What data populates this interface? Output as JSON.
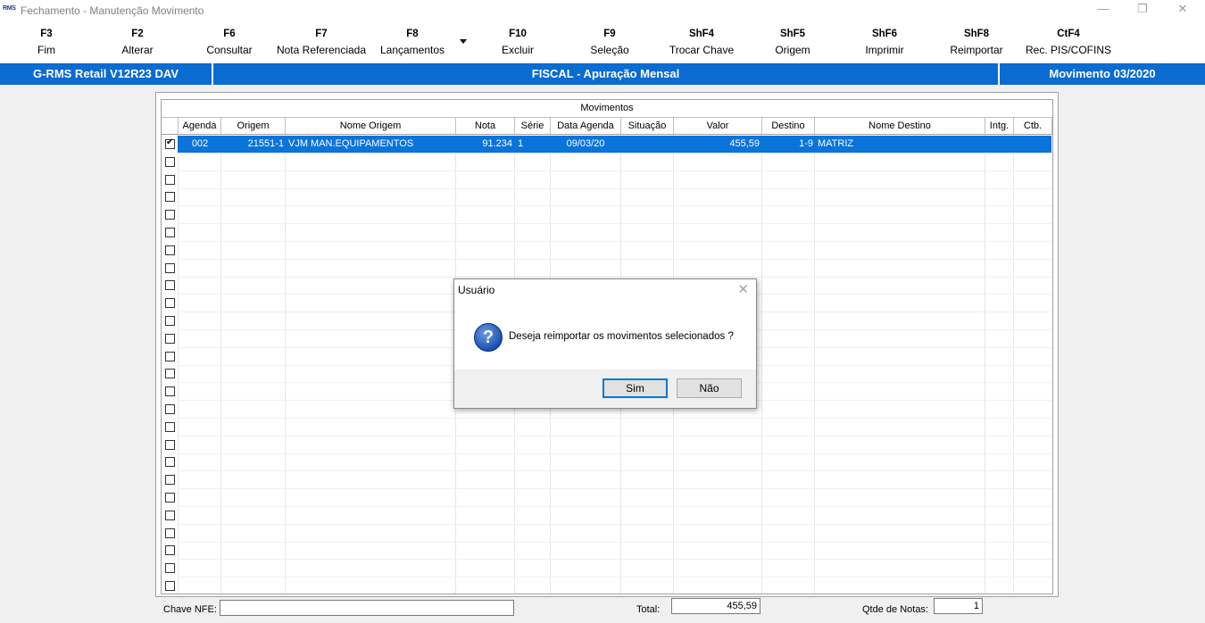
{
  "window": {
    "logo": "RMS",
    "title": "Fechamento - Manutenção Movimento",
    "minimize_glyph": "—",
    "restore_glyph": "❐",
    "close_glyph": "✕"
  },
  "toolbar": {
    "items": [
      {
        "key": "F3",
        "label": "Fim"
      },
      {
        "key": "F2",
        "label": "Alterar"
      },
      {
        "key": "F6",
        "label": "Consultar"
      },
      {
        "key": "F7",
        "label": "Nota Referenciada"
      },
      {
        "key": "F8",
        "label": "Lançamentos"
      },
      {
        "key": "F10",
        "label": "Excluir"
      },
      {
        "key": "F9",
        "label": "Seleção"
      },
      {
        "key": "ShF4",
        "label": "Trocar Chave"
      },
      {
        "key": "ShF5",
        "label": "Origem"
      },
      {
        "key": "ShF6",
        "label": "Imprimir"
      },
      {
        "key": "ShF8",
        "label": "Reimportar"
      },
      {
        "key": "CtF4",
        "label": "Rec. PIS/COFINS"
      }
    ]
  },
  "status_bar": {
    "product": "G-RMS Retail V12R23 DAV",
    "module": "FISCAL - Apuração Mensal",
    "period": "Movimento 03/2020",
    "color": "#0a6bd0"
  },
  "grid": {
    "title": "Movimentos",
    "columns": [
      "Agenda",
      "Origem",
      "Nome Origem",
      "Nota",
      "Série",
      "Data Agenda",
      "Situação",
      "Valor",
      "Destino",
      "Nome Destino",
      "Intg.",
      "Ctb."
    ],
    "rows": [
      {
        "checked": true,
        "agenda": "002",
        "origem": "21551-1",
        "nome_origem": "VJM MAN.EQUIPAMENTOS",
        "nota": "91.234",
        "serie": "1",
        "data_agenda": "09/03/20",
        "situacao": "",
        "valor": "455,59",
        "destino": "1-9",
        "nome_destino": "MATRIZ",
        "intg": "",
        "ctb": ""
      }
    ],
    "empty_rows": 25,
    "selection_color": "#0a74da"
  },
  "footer": {
    "chave_label": "Chave NFE:",
    "chave_value": "",
    "total_label": "Total:",
    "total_value": "455,59",
    "qtde_label": "Qtde de Notas:",
    "qtde_value": "1"
  },
  "dialog": {
    "title": "Usuário",
    "icon": "question-icon",
    "icon_glyph": "?",
    "message": "Deseja reimportar os movimentos selecionados ?",
    "yes_label": "Sim",
    "no_label": "Não"
  }
}
